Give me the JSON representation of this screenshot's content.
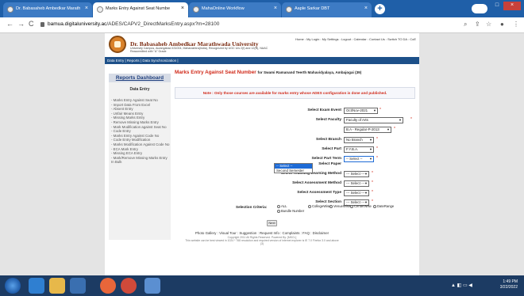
{
  "browser": {
    "tabs": [
      {
        "label": "Dr. Babasaheb Ambedkar Marath",
        "active": false
      },
      {
        "label": "Marks Entry Against Seat Numbe",
        "active": true
      },
      {
        "label": "MahaOnline Workflow",
        "active": false
      },
      {
        "label": "Aaple Sarkar DBT",
        "active": false
      }
    ],
    "new_tab": "+",
    "url_host": "bamua.digitaluniversity.ac",
    "url_path": "/ADES/CAPV2_DirectMarksEntry.aspx?m=28100",
    "back": "←",
    "forward": "→",
    "reload": "C"
  },
  "site": {
    "name": "Dr. Babasaheb Ambedkar Marathwada University",
    "subtitle": "University Campus, Aurangabad 431004, Maharashtra(India), Recognized by UGC U/s 2(f) and 12(B), NAAC",
    "subtitle2": "Reaccredited with \"A\" Grade",
    "top_links": "Home : My Login : My Settings : Logout : Calendar : Contact Us : Switch TO DA : CoE",
    "menubar": "Data Entry | Reports | Data Synchronization |"
  },
  "sidebar": {
    "title": "Reports Dashboard",
    "section": "Data Entry",
    "items": [
      "- Marks Entry Against Seat No",
      "- Import Data From Excel",
      "- Absent Entry",
      "- Unfair Means Entry",
      "- Missing Marks Entry",
      "- Remove Missing Marks Entry",
      "- Mark Modification against Seat No",
      "- Code Entry",
      "- Marks Entry Against Code No",
      "- Code Entry Modification",
      "- Marks Modification Against Code No",
      "- ECA Mark Entry",
      "- Missing ECA Entry",
      "- Mark/Remove Missing Marks Entry In Bulk"
    ]
  },
  "main": {
    "title": "Marks Entry Against Seat Number",
    "institute": "for Swami Ramanand Teerth Mahavidyalaya, Ambajogai (39)",
    "note": "Note : Only those courses are available for marks entry whose ADES configuration is done and published.",
    "fields": [
      {
        "label": "Select Exam Event",
        "value": "Oct/Nov-2021"
      },
      {
        "label": "Select Faculty",
        "value": "Faculty of Arts"
      },
      {
        "label": "",
        "value": "B.A - Regular-P-2013"
      },
      {
        "label": "Select Branch",
        "value": "No Branch"
      },
      {
        "label": "Select Part",
        "value": "F.Y.B.A."
      },
      {
        "label": "Select Part Term",
        "value": "-- Select --"
      },
      {
        "label": "Select Paper",
        "value": ""
      },
      {
        "label": "Select Teaching Learning Method",
        "value": "--- Select ---"
      },
      {
        "label": "Select Assessment Method",
        "value": "--- Select ---"
      },
      {
        "label": "Select Assessment Type",
        "value": "--- Select ---"
      },
      {
        "label": "Select Section",
        "value": "--- Select ---"
      }
    ],
    "required_mark": "*",
    "dropdown_options": [
      "-- Select --",
      "Second Semester"
    ],
    "criteria_label": "Selection Criteria:",
    "criteria_options": [
      "ALL",
      "CollegeWise",
      "VenueWise",
      "CenterWise",
      "DateRange",
      "Bundle Number"
    ],
    "next_button": "Next"
  },
  "footer": {
    "links": "Photo Gallery : Visual Tour : Suggestion : Request Info : Complaints : FAQ : Disclaimer",
    "copyright": "Copyright 2011 All Rights Reserved. Powered By: [MKCL]",
    "note": "This website can be best viewed in 1024 * 768 resolution and required version of internet explorer is IE 7.0 Firefox 3.0 and above",
    "num": "(3)"
  },
  "taskbar": {
    "time": "1:49 PM",
    "date": "3/22/2022"
  },
  "colors": {
    "accent": "#1d5089",
    "title_red": "#d02a1a",
    "tab_bar": "#1f5fa8"
  }
}
